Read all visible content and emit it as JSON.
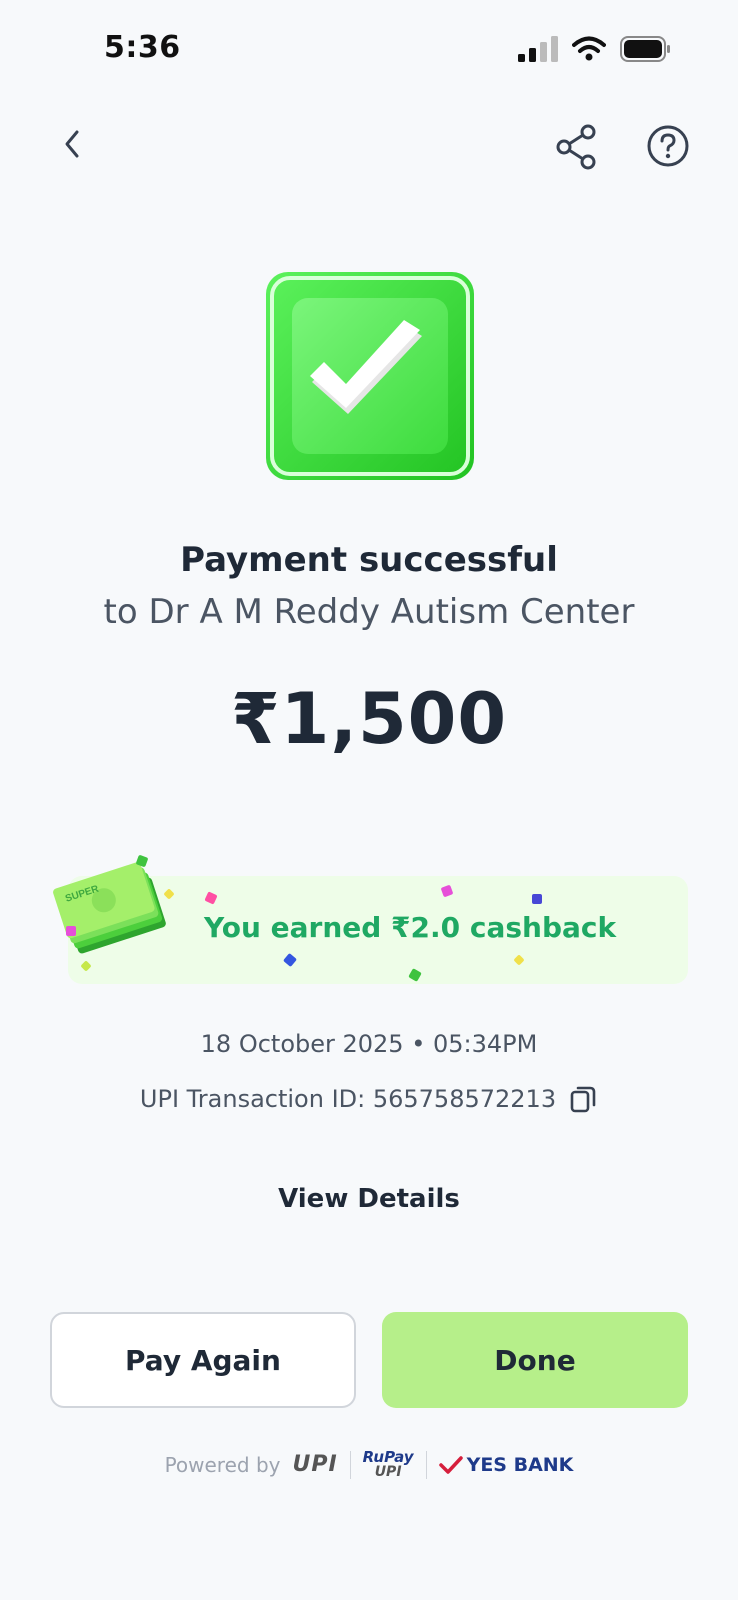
{
  "status_bar": {
    "time": "5:36"
  },
  "header": {
    "back_icon": "chevron-left-icon",
    "share_icon": "share-icon",
    "help_icon": "help-circle-icon"
  },
  "payment": {
    "title": "Payment successful",
    "recipient": "to Dr A M Reddy Autism Center",
    "amount": "₹1,500"
  },
  "cashback": {
    "text": "You earned ₹2.0 cashback",
    "art_label": "SUPER"
  },
  "transaction": {
    "datetime": "18 October 2025 • 05:34PM",
    "upi_id_text": "UPI Transaction ID: 565758572213"
  },
  "actions": {
    "view_details": "View Details",
    "pay_again": "Pay Again",
    "done": "Done"
  },
  "footer": {
    "powered_by": "Powered by",
    "upi_logo": "UPI",
    "rupay_logo_top": "RuPay",
    "rupay_logo_bottom": "UPI",
    "bank": "YES BANK"
  },
  "colors": {
    "background": "#f7f9fb",
    "success_green": "#3be03b",
    "cashback_text": "#1fa863",
    "done_button": "#b6ef8a",
    "text_primary": "#1f2937"
  }
}
